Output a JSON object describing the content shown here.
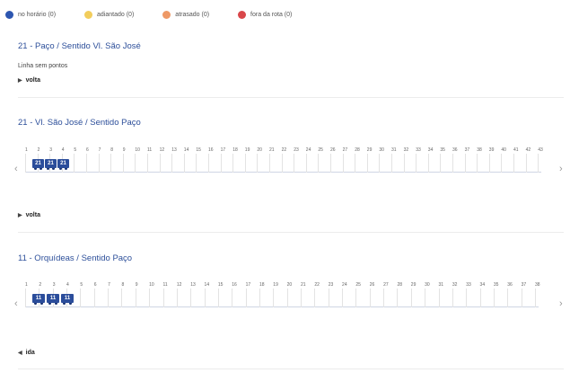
{
  "legend": [
    {
      "label": "no horário (0)",
      "color": "#2d56b0"
    },
    {
      "label": "adiantado (0)",
      "color": "#f2cd5c"
    },
    {
      "label": "atrasado (0)",
      "color": "#ee9966"
    },
    {
      "label": "fora da rota (0)",
      "color": "#d9474a"
    }
  ],
  "routes": [
    {
      "title": "21 - Paço / Sentido Vl. São José",
      "message": "Linha sem pontos",
      "direction": "volta"
    },
    {
      "title": "21 - Vl. São José / Sentido Paço",
      "stops": [
        "1",
        "2",
        "3",
        "4",
        "5",
        "6",
        "7",
        "8",
        "9",
        "10",
        "11",
        "12",
        "13",
        "14",
        "15",
        "16",
        "17",
        "18",
        "19",
        "20",
        "21",
        "22",
        "23",
        "24",
        "25",
        "26",
        "27",
        "28",
        "29",
        "30",
        "31",
        "32",
        "33",
        "34",
        "35",
        "36",
        "37",
        "38",
        "39",
        "40",
        "41",
        "42",
        "43"
      ],
      "buses": [
        "21",
        "21",
        "21"
      ],
      "direction": "volta"
    },
    {
      "title": "11 - Orquídeas / Sentido Paço",
      "stops": [
        "1",
        "2",
        "3",
        "4",
        "5",
        "6",
        "7",
        "8",
        "9",
        "10",
        "11",
        "12",
        "13",
        "14",
        "15",
        "16",
        "17",
        "18",
        "19",
        "20",
        "21",
        "22",
        "23",
        "24",
        "25",
        "26",
        "27",
        "28",
        "29",
        "30",
        "31",
        "32",
        "33",
        "34",
        "35",
        "36",
        "37",
        "38"
      ],
      "buses": [
        "11",
        "11",
        "11"
      ],
      "direction": "ida"
    }
  ],
  "icons": {
    "prev": "chevron-left-icon",
    "next": "chevron-right-icon",
    "direction": "arrow-icon"
  }
}
